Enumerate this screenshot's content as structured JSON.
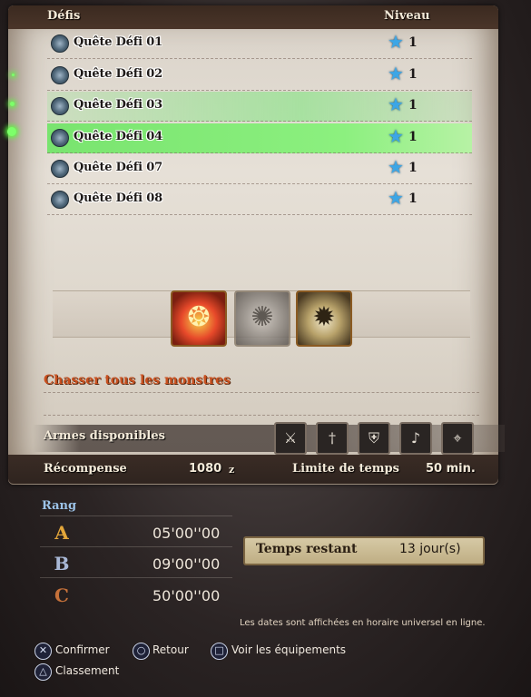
{
  "header": {
    "title": "Défis",
    "level_label": "Niveau"
  },
  "quests": [
    {
      "name": "Quête Défi 01",
      "level": "1"
    },
    {
      "name": "Quête Défi 02",
      "level": "1"
    },
    {
      "name": "Quête Défi 03",
      "level": "1"
    },
    {
      "name": "Quête Défi 04",
      "level": "1"
    },
    {
      "name": "Quête Défi 07",
      "level": "1"
    },
    {
      "name": "Quête Défi 08",
      "level": "1"
    }
  ],
  "objective": "Chasser tous les monstres",
  "weapons_label": "Armes disponibles",
  "footer": {
    "reward_label": "Récompense",
    "reward_value": "1080",
    "reward_unit": "z",
    "time_limit_label": "Limite de temps",
    "time_limit_value": "50 min."
  },
  "rank": {
    "title": "Rang",
    "entries": [
      {
        "badge": "A",
        "time": "05'00''00",
        "color": "#e3a63a"
      },
      {
        "badge": "B",
        "time": "09'00''00",
        "color": "#a9b8d6"
      },
      {
        "badge": "C",
        "time": "50'00''00",
        "color": "#c6713a"
      }
    ]
  },
  "time_remaining": {
    "label": "Temps restant",
    "value": "13 jour(s)"
  },
  "note": "Les dates sont affichées en horaire universel en ligne.",
  "controls": {
    "confirm": "Confirmer",
    "back": "Retour",
    "equipment": "Voir les équipements",
    "ranking": "Classement"
  }
}
